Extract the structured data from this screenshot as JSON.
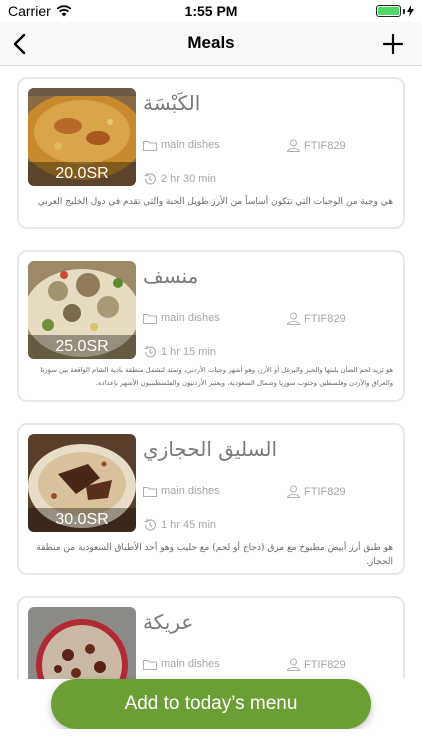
{
  "status_bar": {
    "carrier": "Carrier",
    "time": "1:55 PM"
  },
  "nav": {
    "title": "Meals",
    "back_icon": "chevron-left-icon",
    "add_icon": "plus-icon"
  },
  "meals": [
    {
      "name": "الكَبْسَة",
      "price": "20.0SR",
      "category": "main dishes",
      "code": "FTIF829",
      "duration": "2 hr 30 min",
      "description": "هي وجبة من الوجبات التي تتكون أساساً من الأرز طويل الحبة والتي تقدم في دول الخليج العربي"
    },
    {
      "name": "منسف",
      "price": "25.0SR",
      "category": "main dishes",
      "code": "FTIF829",
      "duration": "1 hr 15 min",
      "description": "هو ثريد لحم الضأن بلبنها والخبز والبرغل أو الأرز، وهو أشهر وجبات الأردني، وتمتد لتشمل منطقة بادية الشام الواقعة بين سوريا والعراق والأردن وفلسطين وجنوب سوريا وشمال السعودية، ويعتبر الأردنيون والفلسطينيون الأشهر بإعداده."
    },
    {
      "name": "السليق الحجازي",
      "price": "30.0SR",
      "category": "main dishes",
      "code": "FTIF829",
      "duration": "1 hr 45 min",
      "description": "هو طبق أرز أبيض مطبوخ مع مرق (دجاج أو لحم) مع حليب وهو أحد الأطباق السعودية من منطقة الحجاز."
    },
    {
      "name": "عريكة",
      "category": "main dishes",
      "code": "FTIF829"
    }
  ],
  "cta": {
    "label": "Add to today’s menu"
  },
  "colors": {
    "accent": "#6b9e35",
    "battery": "#4cd964"
  }
}
